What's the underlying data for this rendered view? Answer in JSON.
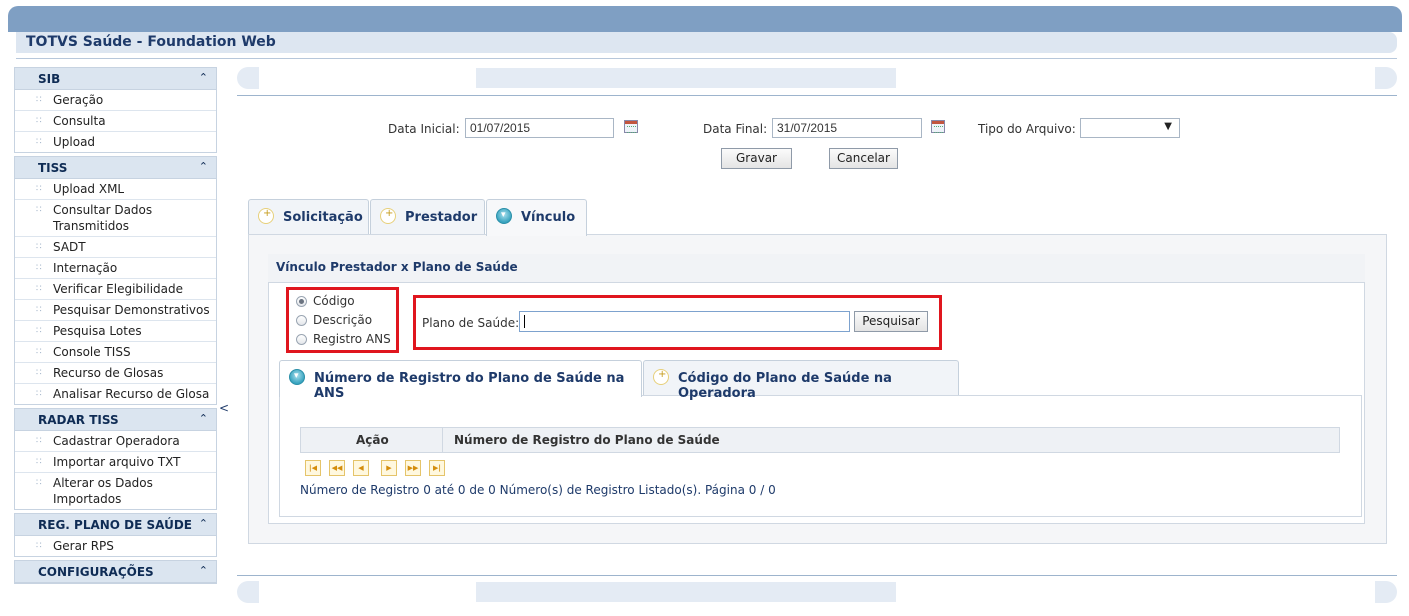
{
  "app": {
    "title": "TOTVS Saúde - Foundation Web"
  },
  "sidebar": {
    "sections": [
      {
        "title": "SIB",
        "items": [
          "Geração",
          "Consulta",
          "Upload"
        ]
      },
      {
        "title": "TISS",
        "items": [
          "Upload XML",
          "Consultar Dados Transmitidos",
          "SADT",
          "Internação",
          "Verificar Elegibilidade",
          "Pesquisar Demonstrativos",
          "Pesquisa Lotes",
          "Console TISS",
          "Recurso de Glosas",
          "Analisar Recurso de Glosa"
        ]
      },
      {
        "title": "RADAR TISS",
        "items": [
          "Cadastrar Operadora",
          "Importar arquivo TXT",
          "Alterar os Dados Importados"
        ]
      },
      {
        "title": "REG. PLANO DE SAÚDE",
        "items": [
          "Gerar RPS"
        ]
      },
      {
        "title": "CONFIGURAÇÕES",
        "items": []
      }
    ],
    "collapse_glyph": "<"
  },
  "form": {
    "data_inicial_label": "Data Inicial:",
    "data_inicial_value": "01/07/2015",
    "data_final_label": "Data Final:",
    "data_final_value": "31/07/2015",
    "tipo_label": "Tipo do Arquivo:",
    "tipo_value": "",
    "gravar": "Gravar",
    "cancelar": "Cancelar"
  },
  "tabs": [
    {
      "label": "Solicitação",
      "active": false
    },
    {
      "label": "Prestador",
      "active": false
    },
    {
      "label": "Vínculo",
      "active": true
    }
  ],
  "vinculo": {
    "title": "Vínculo Prestador x Plano de Saúde",
    "radios": [
      {
        "label": "Código",
        "selected": true
      },
      {
        "label": "Descrição",
        "selected": false
      },
      {
        "label": "Registro ANS",
        "selected": false
      }
    ],
    "plano_label": "Plano de Saúde:",
    "plano_value": "",
    "pesquisar": "Pesquisar",
    "subtabs": [
      {
        "label": "Número de Registro do Plano de Saúde na ANS",
        "active": true
      },
      {
        "label": "Código do Plano de Saúde na Operadora",
        "active": false
      }
    ],
    "grid": {
      "columns": [
        "Ação",
        "Número de Registro do Plano de Saúde"
      ],
      "pager_info": "Número de Registro 0 até 0 de 0 Número(s) de Registro Listado(s). Página 0 / 0"
    }
  },
  "icons": {
    "calendar": "calendar-icon",
    "expand": "chevron-up-icon"
  },
  "colors": {
    "header_bar": "#7f9fc3",
    "accent": "#1e3a6a",
    "highlight": "#e0161e"
  }
}
